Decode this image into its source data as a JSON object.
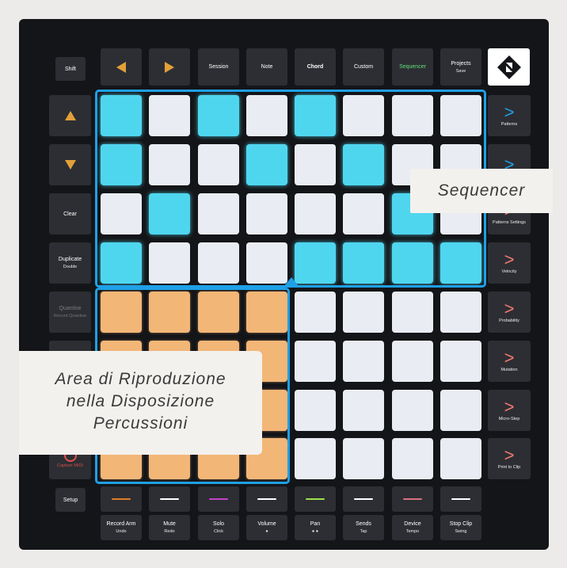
{
  "top_buttons": [
    {
      "label": "",
      "icon": "arrow-left-icon"
    },
    {
      "label": "",
      "icon": "arrow-right-icon"
    },
    {
      "label": "Session",
      "sub": ""
    },
    {
      "label": "Note",
      "sub": ""
    },
    {
      "label": "Chord",
      "sub": ""
    },
    {
      "label": "Custom",
      "sub": ""
    },
    {
      "label": "Sequencer",
      "sub": ""
    },
    {
      "label": "Projects",
      "sub": "Save"
    }
  ],
  "shift_label": "Shift",
  "left_buttons": [
    {
      "label": "",
      "sub": "",
      "icon": "arrow-up-icon"
    },
    {
      "label": "",
      "sub": "",
      "icon": "arrow-down-icon"
    },
    {
      "label": "Clear",
      "sub": ""
    },
    {
      "label": "Duplicate",
      "sub": "Double"
    },
    {
      "label": "Quantise",
      "sub": "Record Quantise"
    },
    {
      "label": "",
      "sub": ""
    },
    {
      "label": "",
      "sub": ""
    },
    {
      "label": "",
      "sub": "Capture MIDI"
    }
  ],
  "setup_label": "Setup",
  "right_buttons": [
    {
      "sub": "Patterns"
    },
    {
      "sub": ""
    },
    {
      "sub": "Patterns Settings"
    },
    {
      "sub": "Velocity"
    },
    {
      "sub": "Probability"
    },
    {
      "sub": "Mutation"
    },
    {
      "sub": "Micro-Step"
    },
    {
      "sub": "Print to Clip"
    }
  ],
  "bottom_buttons": [
    {
      "label": "Record Arm",
      "sub": "Undo"
    },
    {
      "label": "Mute",
      "sub": "Redo"
    },
    {
      "label": "Solo",
      "sub": "Click"
    },
    {
      "label": "Volume",
      "sub": "●"
    },
    {
      "label": "Pan",
      "sub": "● ●"
    },
    {
      "label": "Sends",
      "sub": "Tap"
    },
    {
      "label": "Device",
      "sub": "Tempo"
    },
    {
      "label": "Stop Clip",
      "sub": "Swing"
    }
  ],
  "track_stripe_colors": [
    "#e07b2a",
    "#ffffff",
    "#c243c9",
    "#ffffff",
    "#9ee04a",
    "#ffffff",
    "#d7737f",
    "#ffffff"
  ],
  "pad_grid": [
    [
      "cyan",
      "white",
      "cyan",
      "white",
      "cyan",
      "white",
      "white",
      "white"
    ],
    [
      "cyan",
      "white",
      "white",
      "cyan",
      "white",
      "cyan",
      "white",
      "white"
    ],
    [
      "white",
      "cyan",
      "white",
      "white",
      "white",
      "white",
      "cyan",
      "white"
    ],
    [
      "cyan",
      "white",
      "white",
      "white",
      "cyan",
      "cyan",
      "cyan",
      "cyan"
    ],
    [
      "orange",
      "orange",
      "orange",
      "orange",
      "white",
      "white",
      "white",
      "white"
    ],
    [
      "orange",
      "orange",
      "orange",
      "orange",
      "white",
      "white",
      "white",
      "white"
    ],
    [
      "orange",
      "orange",
      "orange",
      "orange",
      "white",
      "white",
      "white",
      "white"
    ],
    [
      "orange",
      "orange",
      "orange",
      "orange",
      "white",
      "white",
      "white",
      "white"
    ]
  ],
  "colors": {
    "cyan": "#4fd6ef",
    "white": "#e9ecf3",
    "orange": "#f2b677",
    "arrow_orange": "#e2a038",
    "right_chevron": "#f07a6e",
    "sequencer_label": "#62e07a",
    "capture_midi": "#e0524a",
    "region_border": "#1fa0e6",
    "dim_text": "#7a7b80"
  },
  "callouts": {
    "sequencer": "Sequencer",
    "play_area": [
      "Area di Riproduzione",
      "nella Disposizione",
      "Percussioni"
    ]
  }
}
